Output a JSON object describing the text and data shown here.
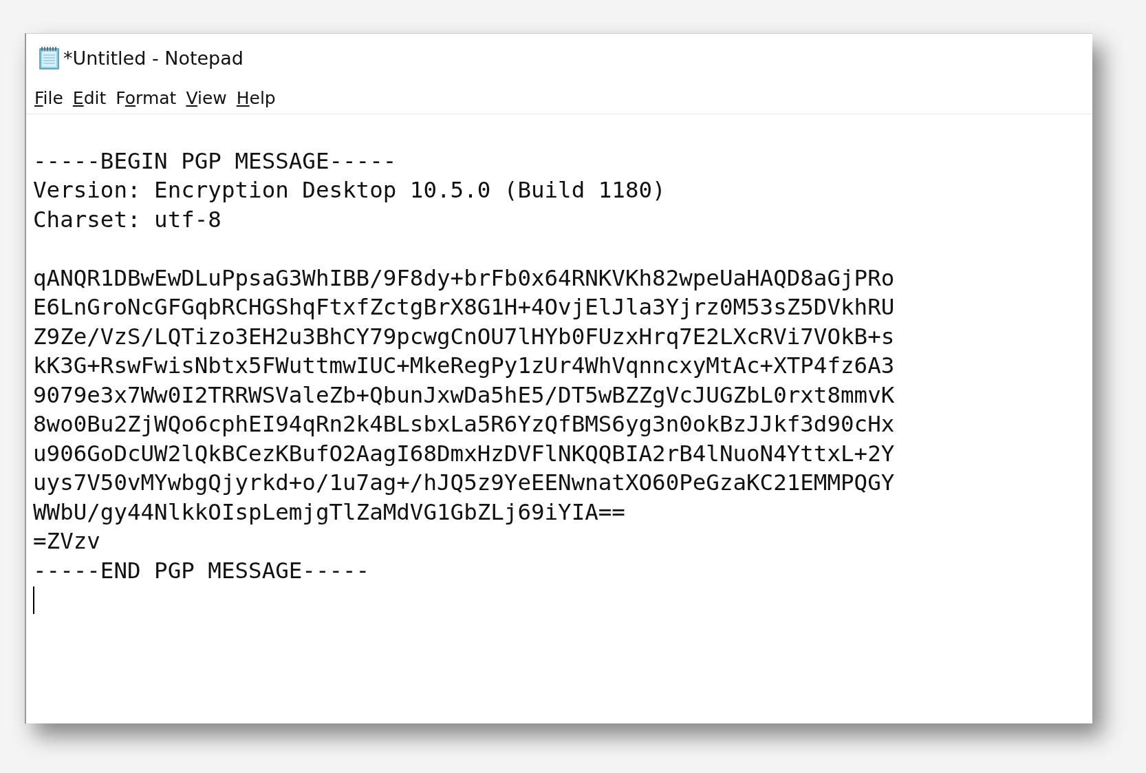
{
  "window": {
    "title": "*Untitled - Notepad"
  },
  "menu": [
    {
      "key": "F",
      "post": "ile"
    },
    {
      "key": "E",
      "post": "dit"
    },
    {
      "pre": "F",
      "key": "o",
      "post": "rmat"
    },
    {
      "key": "V",
      "post": "iew"
    },
    {
      "key": "H",
      "post": "elp"
    }
  ],
  "editor": {
    "header_lines": [
      "-----BEGIN PGP MESSAGE-----",
      "Version: Encryption Desktop 10.5.0 (Build 1180)",
      "Charset: utf-8"
    ],
    "body_lines": [
      "qANQR1DBwEwDLuPpsaG3WhIBB/9F8dy+brFb0x64RNKVKh82wpeUaHAQD8aGjPRo",
      "E6LnGroNcGFGqbRCHGShqFtxfZctgBrX8G1H+4OvjElJla3Yjrz0M53sZ5DVkhRU",
      "Z9Ze/VzS/LQTizo3EH2u3BhCY79pcwgCnOU7lHYb0FUzxHrq7E2LXcRVi7VOkB+s",
      "kK3G+RswFwisNbtx5FWuttmwIUC+MkeRegPy1zUr4WhVqnncxyMtAc+XTP4fz6A3",
      "9079e3x7Ww0I2TRRWSValeZb+QbunJxwDa5hE5/DT5wBZZgVcJUGZbL0rxt8mmvK",
      "8wo0Bu2ZjWQo6cphEI94qRn2k4BLsbxLa5R6YzQfBMS6yg3n0okBzJJkf3d90cHx",
      "u906GoDcUW2lQkBCezKBufO2AagI68DmxHzDVFlNKQQBIA2rB4lNuoN4YttxL+2Y",
      "uys7V50vMYwbgQjyrkd+o/1u7ag+/hJQ5z9YeEENwnatXO60PeGzaKC21EMMPQGY",
      "WWbU/gy44NlkkOIspLemjgTlZaMdVG1GbZLj69iYIA==",
      "=ZVzv",
      "-----END PGP MESSAGE-----"
    ]
  }
}
